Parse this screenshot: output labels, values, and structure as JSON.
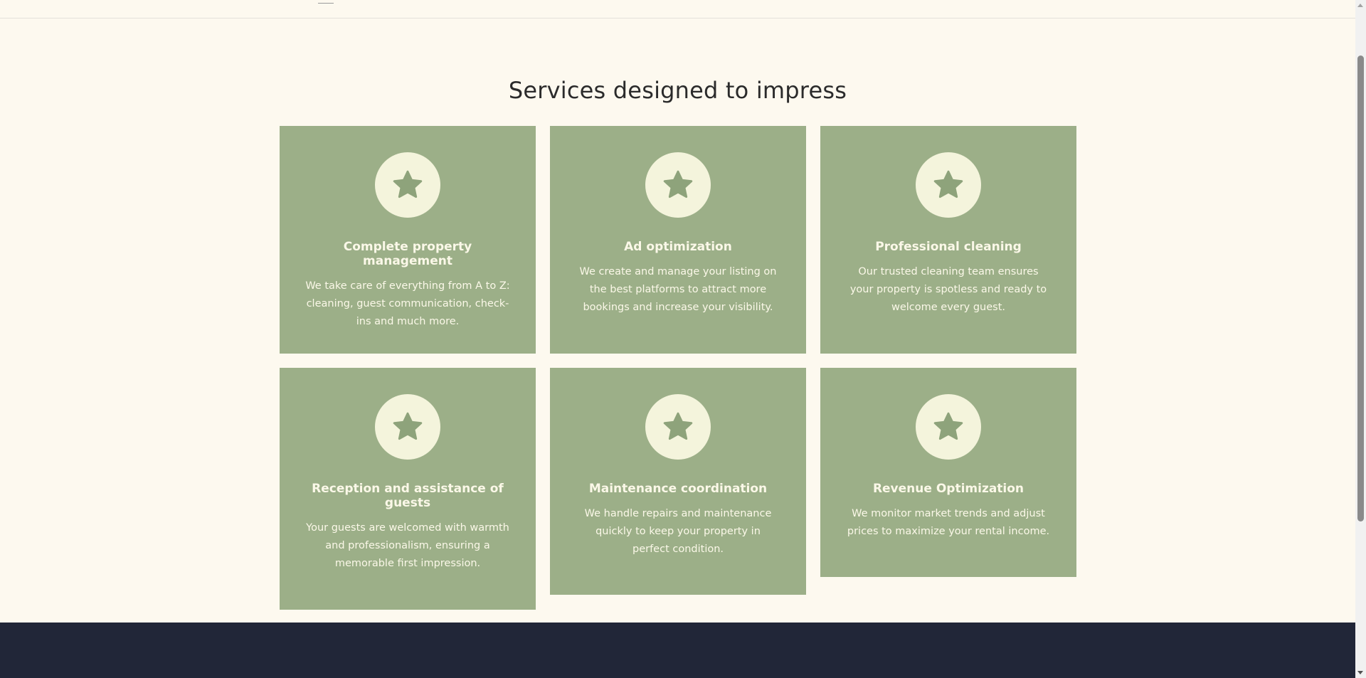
{
  "section": {
    "title": "Services designed to impress"
  },
  "colors": {
    "card_background": "#9caf88",
    "icon_circle": "#f4f4dc",
    "page_background": "#fdf9ef",
    "footer_background": "#212638"
  },
  "services": [
    {
      "icon": "star-icon",
      "title": "Complete property management",
      "description": "We take care of everything from A to Z: cleaning, guest communication, check-ins and much more."
    },
    {
      "icon": "star-icon",
      "title": "Ad optimization",
      "description": "We create and manage your listing on the best platforms to attract more bookings and increase your visibility."
    },
    {
      "icon": "star-icon",
      "title": "Professional cleaning",
      "description": "Our trusted cleaning team ensures your property is spotless and ready to welcome every guest."
    },
    {
      "icon": "star-icon",
      "title": "Reception and assistance of guests",
      "description": "Your guests are welcomed with warmth and professionalism, ensuring a memorable first impression."
    },
    {
      "icon": "star-icon",
      "title": "Maintenance coordination",
      "description": "We handle repairs and maintenance quickly to keep your property in perfect condition."
    },
    {
      "icon": "star-icon",
      "title": "Revenue Optimization",
      "description": "We monitor market trends and adjust prices to maximize your rental income."
    }
  ]
}
